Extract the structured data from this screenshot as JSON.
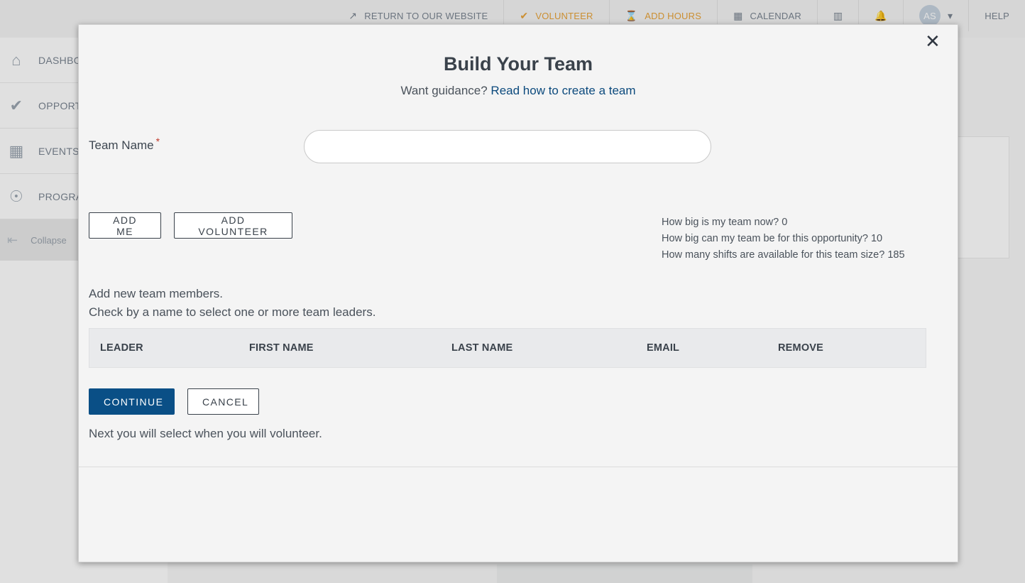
{
  "topnav": {
    "items": [
      {
        "label": "RETURN TO OUR WEBSITE",
        "icon": "external-link-icon"
      },
      {
        "label": "VOLUNTEER",
        "icon": "check-circle-icon"
      },
      {
        "label": "ADD HOURS",
        "icon": "hourglass-icon"
      },
      {
        "label": "CALENDAR",
        "icon": "calendar-icon"
      }
    ],
    "avatar_initials": "AS",
    "help_label": "HELP"
  },
  "sidebar": {
    "items": [
      {
        "label": "DASHBO",
        "icon": "home-icon"
      },
      {
        "label": "OPPORT",
        "icon": "check-circle-icon"
      },
      {
        "label": "EVENTS",
        "icon": "calendar-icon"
      },
      {
        "label": "PROGRA",
        "icon": "hands-globe-icon"
      }
    ],
    "collapse_label": "Collapse"
  },
  "modal": {
    "title": "Build Your Team",
    "guidance_prefix": "Want guidance?",
    "guidance_link": "Read how to create a team",
    "team_name_label": "Team Name",
    "team_name_required": "*",
    "team_name_value": "",
    "add_me_label": "ADD ME",
    "add_volunteer_label": "ADD VOLUNTEER",
    "stats": {
      "team_size_now": "How big is my team now? 0",
      "team_size_max": "How big can my team be for this opportunity? 10",
      "shifts_available": "How many shifts are available for this team size? 185"
    },
    "info_line1": "Add new team members.",
    "info_line2": "Check by a name to select one or more team leaders.",
    "table_headers": [
      "LEADER",
      "FIRST NAME",
      "LAST NAME",
      "EMAIL",
      "REMOVE"
    ],
    "continue_label": "CONTINUE",
    "cancel_label": "CANCEL",
    "next_note": "Next you will select when you will volunteer."
  },
  "colors": {
    "primary": "#0a4f86",
    "link": "#0c4a7d",
    "accent": "#e8a33a",
    "required": "#c0392b"
  }
}
